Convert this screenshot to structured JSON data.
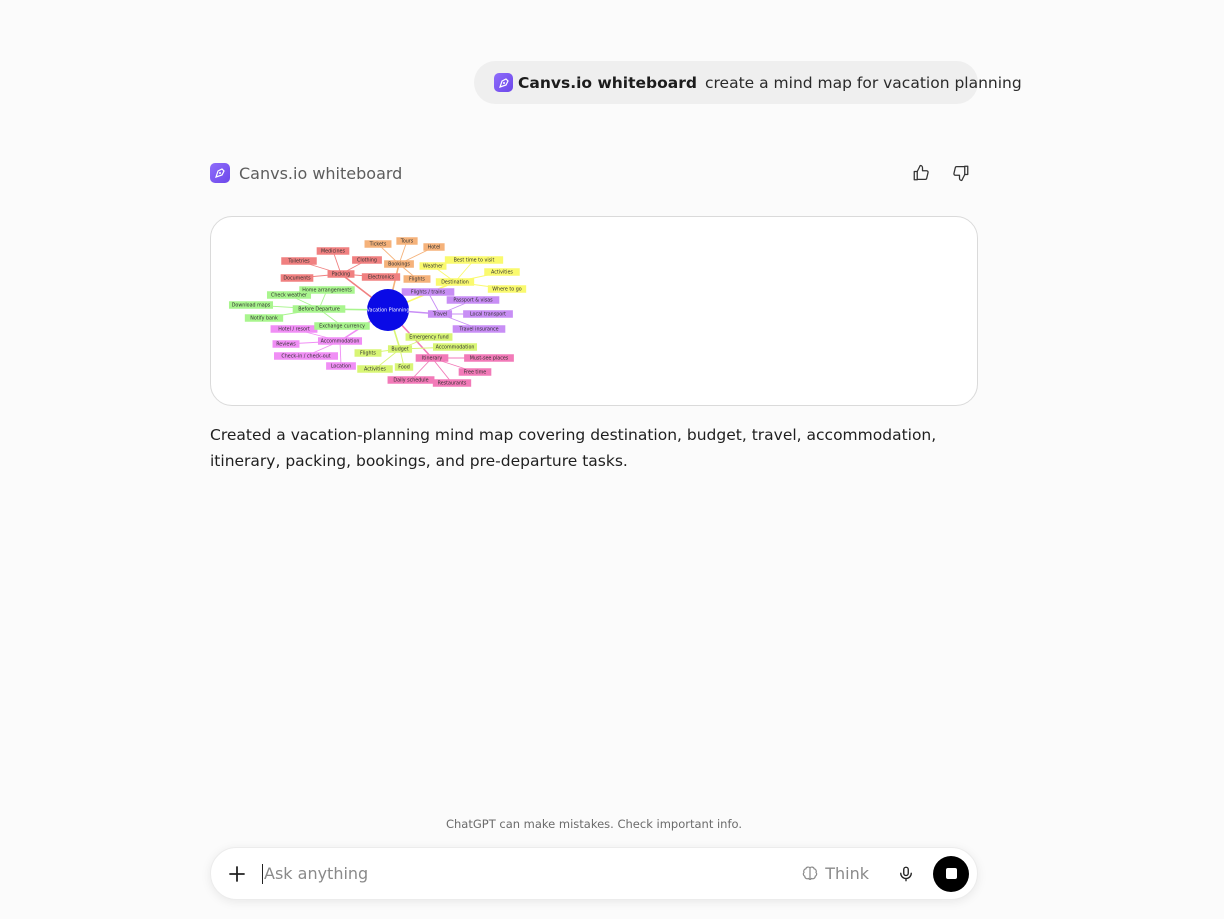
{
  "user_message": {
    "gpt_name": "Canvs.io whiteboard",
    "text": "create a mind map for vacation planning"
  },
  "assistant": {
    "name": "Canvs.io whiteboard",
    "icons": {
      "app": "pen-nib-icon",
      "like": "thumbs-up-icon",
      "dislike": "thumbs-down-icon"
    },
    "answer": "Created a vacation-planning mind map covering destination, budget, travel, accommodation, itinerary, packing, bookings, and pre-departure tasks."
  },
  "mindmap": {
    "center": "Vacation Planning",
    "center_color": "#0a0ae6",
    "branches": [
      {
        "name": "Packing",
        "color": "#f08080",
        "children": [
          "Medicines",
          "Clothing",
          "Toiletries",
          "Documents",
          "Electronics"
        ]
      },
      {
        "name": "Bookings",
        "color": "#f5b27a",
        "children": [
          "Tickets",
          "Tours",
          "Hotel",
          "Flights"
        ]
      },
      {
        "name": "Destination",
        "color": "#fafa6e",
        "children": [
          "Best time to visit",
          "Weather",
          "Activities",
          "Where to go"
        ]
      },
      {
        "name": "Travel",
        "color": "#c88ef5",
        "children": [
          "Flights / trains",
          "Passport & visas",
          "Local transport",
          "Travel insurance"
        ]
      },
      {
        "name": "Itinerary",
        "color": "#f27ab8",
        "children": [
          "Must-see places",
          "Free time",
          "Daily schedule",
          "Restaurants"
        ]
      },
      {
        "name": "Budget",
        "color": "#d8f575",
        "children": [
          "Emergency fund",
          "Accommodation",
          "Flights",
          "Food",
          "Activities"
        ]
      },
      {
        "name": "Accommodation",
        "color": "#f08ef5",
        "children": [
          "Hotel / resort",
          "Reviews",
          "Check-in / check-out",
          "Location"
        ]
      },
      {
        "name": "Before Departure",
        "color": "#a9f58e",
        "children": [
          "Home arrangements",
          "Check weather",
          "Download maps",
          "Notify bank",
          "Exchange currency"
        ]
      }
    ]
  },
  "composer": {
    "placeholder": "Ask anything",
    "think_label": "Think",
    "icons": {
      "add": "plus-icon",
      "think": "brain-icon",
      "mic": "microphone-icon",
      "stop": "stop-icon"
    }
  },
  "disclaimer": "ChatGPT can make mistakes. Check important info."
}
